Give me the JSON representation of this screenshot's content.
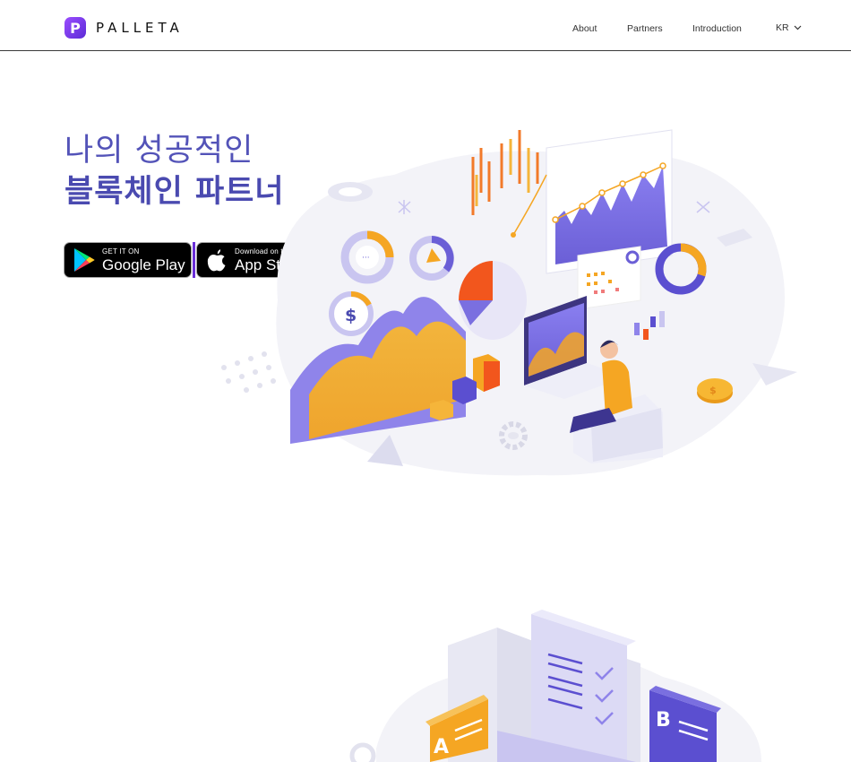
{
  "header": {
    "logo_letter": "P",
    "logo_text": "PALLETA",
    "nav": [
      {
        "label": "About"
      },
      {
        "label": "Partners"
      },
      {
        "label": "Introduction"
      }
    ],
    "lang": "KR"
  },
  "hero": {
    "line1": "나의 성공적인",
    "line2": "블록체인 파트너"
  },
  "stores": {
    "google": {
      "small": "GET IT ON",
      "big": "Google Play",
      "icon": "google-play-icon"
    },
    "apple": {
      "small": "Download on the",
      "big": "App Store",
      "icon": "apple-icon"
    }
  },
  "colors": {
    "brand_purple": "#5b2bd6",
    "title_blue": "#4a4ab0",
    "accent_orange": "#f5a623",
    "accent_indigo": "#6b5fd6"
  }
}
